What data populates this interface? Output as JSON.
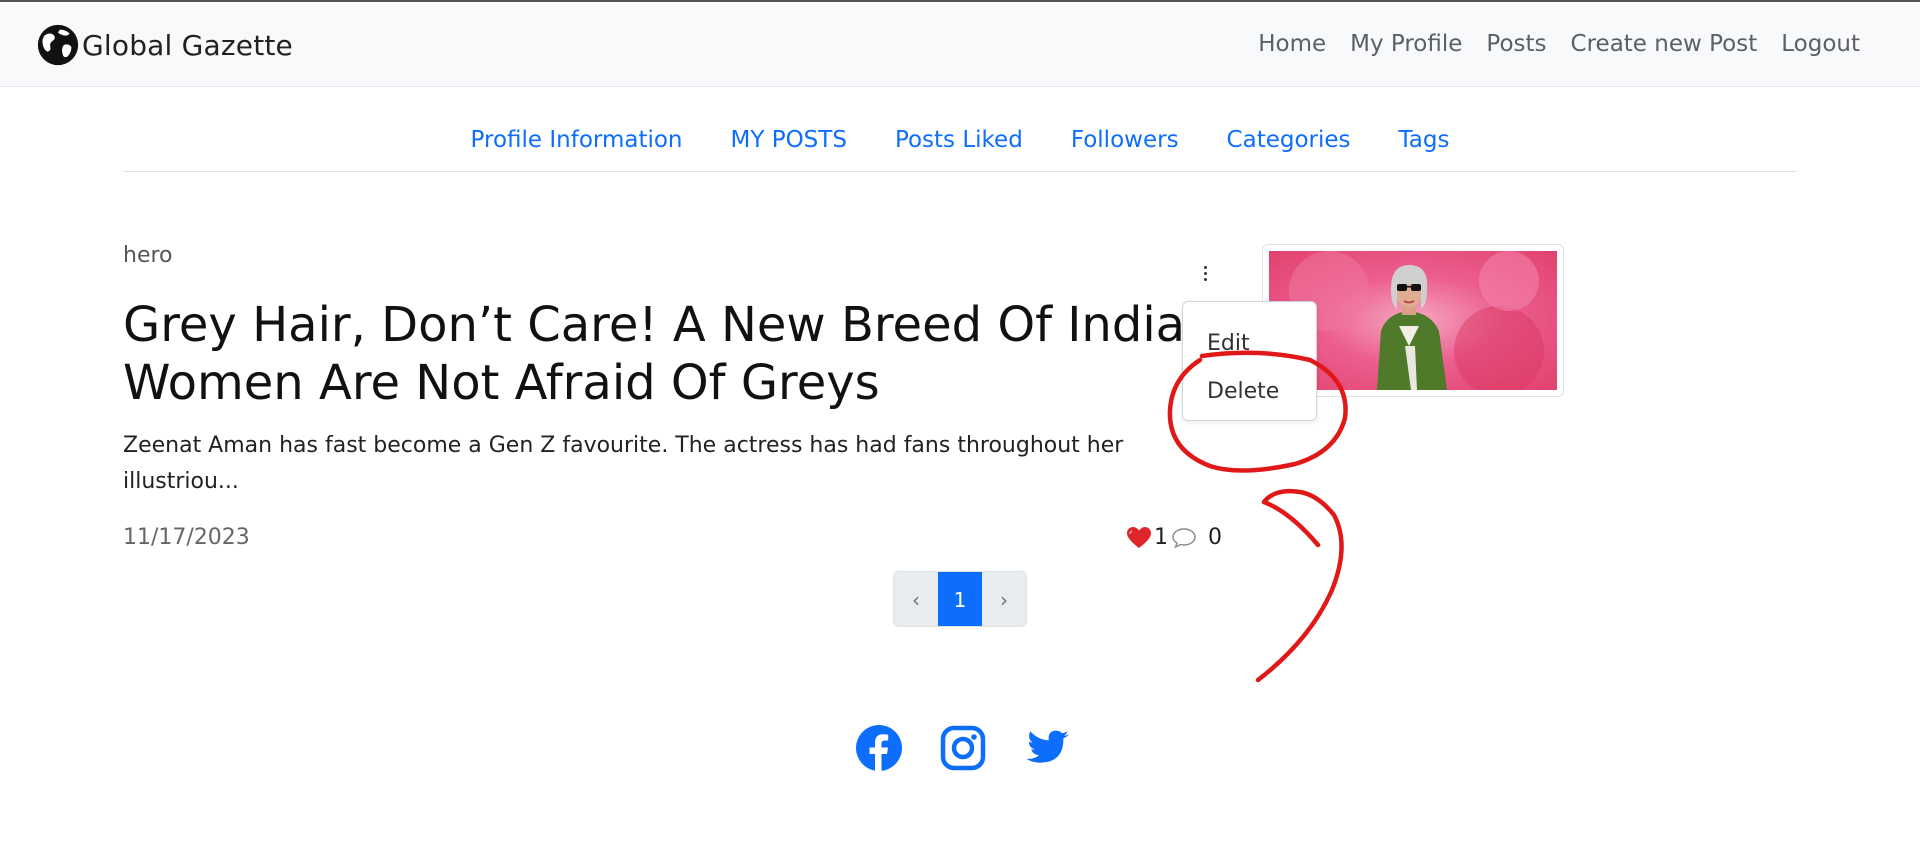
{
  "navbar": {
    "brand": "Global Gazette",
    "links": [
      "Home",
      "My Profile",
      "Posts",
      "Create new Post",
      "Logout"
    ]
  },
  "profile_tabs": [
    "Profile Information",
    "MY POSTS",
    "Posts Liked",
    "Followers",
    "Categories",
    "Tags"
  ],
  "post": {
    "category": "hero",
    "title_line1": "Grey Hair, Don’t Care! A New Breed Of India",
    "title_line2": "Women Are Not Afraid Of Greys",
    "excerpt_line1": "Zeenat Aman has fast become a Gen Z favourite. The actress has had fans throughout her",
    "excerpt_line2": "illustriou...",
    "date": "11/17/2023",
    "likes": "1",
    "comments": "0"
  },
  "post_menu": {
    "edit": "Edit",
    "delete": "Delete"
  },
  "pagination": {
    "prev": "‹",
    "current": "1",
    "next": "›"
  },
  "social_icons": [
    "facebook-icon",
    "instagram-icon",
    "twitter-icon"
  ],
  "colors": {
    "link_blue": "#0d6efd",
    "annotation_red": "#e01818",
    "navbar_bg": "#f8f9fa"
  }
}
